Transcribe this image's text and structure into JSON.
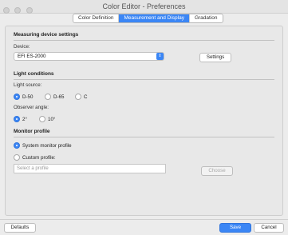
{
  "window": {
    "title": "Color Editor - Preferences"
  },
  "tabs": [
    {
      "label": "Color Definition",
      "active": false
    },
    {
      "label": "Measurement and Display",
      "active": true
    },
    {
      "label": "Gradation",
      "active": false
    }
  ],
  "measuring": {
    "title": "Measuring device settings",
    "device_label": "Device:",
    "device_value": "EFI ES-2000",
    "settings_button": "Settings"
  },
  "light": {
    "title": "Light conditions",
    "source_label": "Light source:",
    "sources": [
      {
        "label": "D-50",
        "selected": true
      },
      {
        "label": "D-65",
        "selected": false
      },
      {
        "label": "C",
        "selected": false
      }
    ],
    "observer_label": "Observer angle:",
    "angles": [
      {
        "label": "2°",
        "selected": true
      },
      {
        "label": "10°",
        "selected": false
      }
    ]
  },
  "monitor": {
    "title": "Monitor profile",
    "system_label": "System monitor profile",
    "system_selected": true,
    "custom_label": "Custom profile:",
    "custom_selected": false,
    "profile_placeholder": "Select a profile",
    "choose_button": "Choose"
  },
  "footer": {
    "defaults_button": "Defaults",
    "save_button": "Save",
    "cancel_button": "Cancel"
  },
  "colors": {
    "accent": "#3b86f5"
  },
  "icons": {
    "help": "question-mark-icon",
    "dropdown": "chevron-updown-icon"
  }
}
